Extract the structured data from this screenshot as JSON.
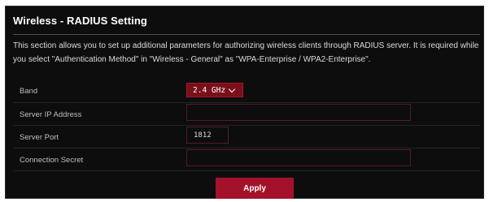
{
  "page": {
    "title": "Wireless - RADIUS Setting",
    "description": "This section allows you to set up additional parameters for authorizing wireless clients through RADIUS server. It is required while you select \"Authentication Method\" in \"Wireless - General\" as \"WPA-Enterprise / WPA2-Enterprise\"."
  },
  "form": {
    "band": {
      "label": "Band",
      "value": "2.4 GHz"
    },
    "server_ip": {
      "label": "Server IP Address",
      "value": ""
    },
    "server_port": {
      "label": "Server Port",
      "value": "1812"
    },
    "connection_secret": {
      "label": "Connection Secret",
      "value": ""
    }
  },
  "actions": {
    "apply_label": "Apply"
  },
  "colors": {
    "accent": "#a3122a",
    "background": "#0d0d0d"
  }
}
